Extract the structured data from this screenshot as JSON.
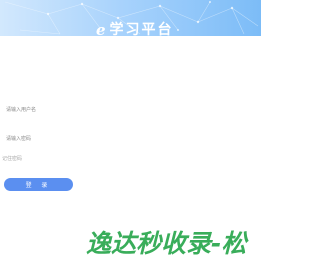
{
  "header": {
    "logo_glyph": "e",
    "title": "学习平台"
  },
  "form": {
    "username": {
      "placeholder": "请输入用户名",
      "value": ""
    },
    "password": {
      "placeholder": "请输入密码",
      "value": ""
    },
    "tip": "记住密码",
    "submit_label": "登 录"
  },
  "watermark": {
    "text": "逸达秒收录-松",
    "color": "#39ad5a"
  },
  "colors": {
    "header_start": "#d2e8fd",
    "header_end": "#7cbcf7",
    "button": "#5b8ff0"
  }
}
